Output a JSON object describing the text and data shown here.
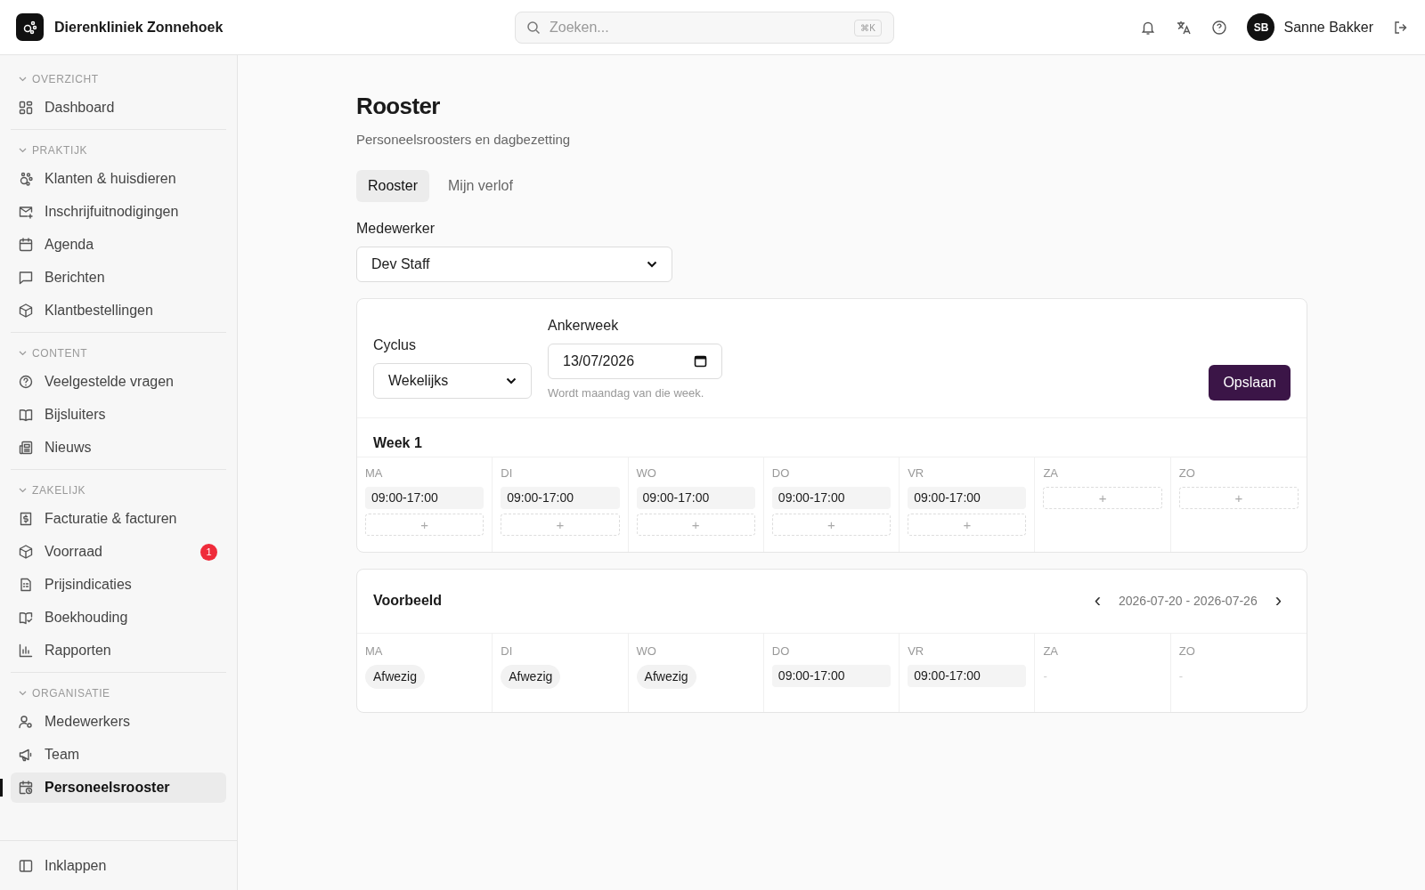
{
  "header": {
    "app_name": "Dierenkliniek Zonnehoek",
    "search": {
      "placeholder": "Zoeken...",
      "shortcut": "⌘K"
    },
    "user": {
      "initials": "SB",
      "name": "Sanne Bakker"
    }
  },
  "sidebar": {
    "sections": [
      {
        "title": "OVERZICHT",
        "items": [
          {
            "label": "Dashboard",
            "selected": false
          }
        ]
      },
      {
        "title": "PRAKTIJK",
        "items": [
          {
            "label": "Klanten & huisdieren",
            "selected": false
          },
          {
            "label": "Inschrijfuitnodigingen",
            "selected": false
          },
          {
            "label": "Agenda",
            "selected": false
          },
          {
            "label": "Berichten",
            "selected": false
          },
          {
            "label": "Klantbestellingen",
            "selected": false
          }
        ]
      },
      {
        "title": "CONTENT",
        "items": [
          {
            "label": "Veelgestelde vragen",
            "selected": false
          },
          {
            "label": "Bijsluiters",
            "selected": false
          },
          {
            "label": "Nieuws",
            "selected": false
          }
        ]
      },
      {
        "title": "ZAKELIJK",
        "items": [
          {
            "label": "Facturatie & facturen",
            "selected": false
          },
          {
            "label": "Voorraad",
            "selected": false,
            "badge": "1"
          },
          {
            "label": "Prijsindicaties",
            "selected": false
          },
          {
            "label": "Boekhouding",
            "selected": false
          },
          {
            "label": "Rapporten",
            "selected": false
          }
        ]
      },
      {
        "title": "ORGANISATIE",
        "items": [
          {
            "label": "Medewerkers",
            "selected": false
          },
          {
            "label": "Team",
            "selected": false
          },
          {
            "label": "Personeelsrooster",
            "selected": true
          }
        ]
      }
    ],
    "collapse": "Inklappen"
  },
  "page": {
    "title": "Rooster",
    "subtitle": "Personeelsroosters en dagbezetting",
    "tabs": [
      {
        "label": "Rooster",
        "selected": true
      },
      {
        "label": "Mijn verlof",
        "selected": false
      }
    ],
    "employee": {
      "label": "Medewerker",
      "value": "Dev Staff"
    },
    "cycle": {
      "label": "Cyclus",
      "value": "Wekelijks"
    },
    "anchor": {
      "label": "Ankerweek",
      "value": "13/07/2026",
      "hint": "Wordt maandag van die week."
    },
    "save": "Opslaan",
    "week": {
      "title": "Week 1",
      "add": "+",
      "days": [
        {
          "label": "MA",
          "shifts": [
            "09:00-17:00"
          ]
        },
        {
          "label": "DI",
          "shifts": [
            "09:00-17:00"
          ]
        },
        {
          "label": "WO",
          "shifts": [
            "09:00-17:00"
          ]
        },
        {
          "label": "DO",
          "shifts": [
            "09:00-17:00"
          ]
        },
        {
          "label": "VR",
          "shifts": [
            "09:00-17:00"
          ]
        },
        {
          "label": "ZA"
        },
        {
          "label": "ZO"
        }
      ]
    },
    "preview": {
      "title": "Voorbeeld",
      "range": "2026-07-20 - 2026-07-26",
      "prev": "‹",
      "next": "›",
      "days": [
        {
          "label": "MA",
          "kind": "absent",
          "text": "Afwezig"
        },
        {
          "label": "DI",
          "kind": "absent",
          "text": "Afwezig"
        },
        {
          "label": "WO",
          "kind": "absent",
          "text": "Afwezig"
        },
        {
          "label": "DO",
          "kind": "shift",
          "text": "09:00-17:00"
        },
        {
          "label": "VR",
          "kind": "shift",
          "text": "09:00-17:00"
        },
        {
          "label": "ZA",
          "kind": "empty",
          "text": "-"
        },
        {
          "label": "ZO",
          "kind": "empty",
          "text": "-"
        }
      ]
    }
  }
}
